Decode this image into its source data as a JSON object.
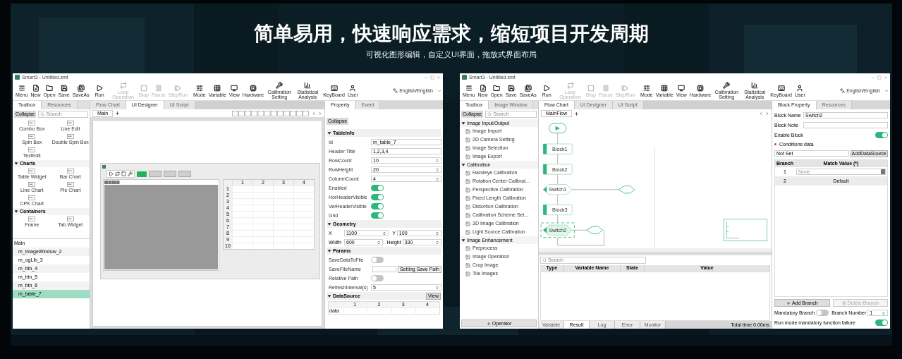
{
  "banner": {
    "title": "简单易用，快速响应需求，缩短项目开发周期",
    "subtitle": "可视化图形编辑，自定义UI界面，拖放式界面布局"
  },
  "windows": [
    {
      "kind": "ui-designer",
      "title": "Smart3 - Untitled.smt",
      "language": "English/English",
      "toolbar": [
        {
          "label": "Menu",
          "disabled": false
        },
        {
          "label": "New",
          "disabled": false
        },
        {
          "label": "Open",
          "disabled": false
        },
        {
          "label": "Save",
          "disabled": false
        },
        {
          "label": "SaveAs",
          "disabled": false
        },
        {
          "label": "Run",
          "disabled": false
        },
        {
          "label": "Loop Operation",
          "disabled": true
        },
        {
          "label": "Stop",
          "disabled": true
        },
        {
          "label": "Pause",
          "disabled": true
        },
        {
          "label": "StepRun",
          "disabled": true
        },
        {
          "label": "Mode",
          "disabled": false
        },
        {
          "label": "Variable",
          "disabled": false
        },
        {
          "label": "View",
          "disabled": false
        },
        {
          "label": "Hardware",
          "disabled": false
        },
        {
          "label": "Calibration Setting",
          "disabled": false
        },
        {
          "label": "Statistical Analysis",
          "disabled": false
        },
        {
          "label": "KeyBoard",
          "disabled": false
        },
        {
          "label": "User",
          "disabled": false
        }
      ],
      "left_tabs": [
        {
          "label": "Toolbox",
          "selected": true
        },
        {
          "label": "Resources",
          "selected": false
        }
      ],
      "collapse": "Collapse",
      "search_placeholder": "Search",
      "widgets_top": [
        "Combo Box",
        "Line Edit",
        "Spin Box",
        "Double Spin Box",
        "TextEdit"
      ],
      "widget_groups": [
        {
          "title": "Charts",
          "expanded": true,
          "items": [
            "Table Widget",
            "Bar Chart",
            "Line Chart",
            "Pie Chart",
            "CPK Chart"
          ]
        },
        {
          "title": "Containers",
          "expanded": true,
          "items": [
            "Frame",
            "Tab Widget"
          ]
        }
      ],
      "tree": {
        "title": "Main",
        "items": [
          {
            "label": "m_imageWindow_2",
            "selected": false
          },
          {
            "label": "m_ogLib_3",
            "selected": false
          },
          {
            "label": "m_btn_4",
            "selected": false
          },
          {
            "label": "m_btn_5",
            "selected": false
          },
          {
            "label": "m_btn_6",
            "selected": false
          },
          {
            "label": "m_table_7",
            "selected": true
          }
        ]
      },
      "center_tabs": [
        {
          "label": "Flow Chart",
          "selected": false
        },
        {
          "label": "UI Designer",
          "selected": true
        },
        {
          "label": "UI Script",
          "selected": false
        }
      ],
      "page_tabs": [
        {
          "label": "Main",
          "selected": true
        }
      ],
      "form": {
        "table_columns": [
          "1",
          "2",
          "3",
          "4"
        ],
        "table_rows": [
          "1",
          "2",
          "3",
          "4",
          "5",
          "6",
          "7",
          "8",
          "9",
          "10"
        ]
      },
      "right_tabs": [
        {
          "label": "Property",
          "selected": true
        },
        {
          "label": "Event",
          "selected": false
        }
      ],
      "property_collapse": "Collapse",
      "sections": [
        {
          "title": "TableInfo",
          "expanded": true,
          "rows": [
            {
              "kind": "text",
              "label": "Id",
              "value": "m_table_7"
            },
            {
              "kind": "text",
              "label": "Header Title",
              "value": "1,2,3,4"
            },
            {
              "kind": "spin",
              "label": "RowCount",
              "value": "10"
            },
            {
              "kind": "spin",
              "label": "RowHeight",
              "value": "20"
            },
            {
              "kind": "spin",
              "label": "ColumnCount",
              "value": "4"
            },
            {
              "kind": "toggle",
              "label": "Enabled",
              "on": true
            },
            {
              "kind": "toggle",
              "label": "HorHeaderVisible",
              "on": true
            },
            {
              "kind": "toggle",
              "label": "VerHeaderVisible",
              "on": true
            },
            {
              "kind": "toggle",
              "label": "Grid",
              "on": true
            }
          ]
        },
        {
          "title": "Geometry",
          "expanded": true,
          "rows": [
            {
              "kind": "pair",
              "label": "X",
              "value": "1100",
              "label2": "Y",
              "value2": "100"
            },
            {
              "kind": "pair",
              "label": "Width",
              "value": "600",
              "label2": "Height",
              "value2": "330"
            }
          ]
        },
        {
          "title": "Params",
          "expanded": true,
          "rows": [
            {
              "kind": "toggle",
              "label": "SaveDataToFile",
              "on": false
            },
            {
              "kind": "path",
              "label": "SaveFileName",
              "button": "Setting Save Path"
            },
            {
              "kind": "toggle",
              "label": "Relative Path",
              "on": false
            },
            {
              "kind": "spin",
              "label": "RefreshInterval(s)",
              "value": "5"
            }
          ]
        },
        {
          "title": "DataSource",
          "expanded": true,
          "button": "View",
          "table": {
            "columns": [
              "1",
              "2",
              "3",
              "4"
            ],
            "rows": [
              "data"
            ]
          }
        }
      ]
    },
    {
      "kind": "flow-chart",
      "title": "Smart3 - Untitled.smt",
      "language": "English/English",
      "toolbar": [
        {
          "label": "Menu",
          "disabled": false
        },
        {
          "label": "New",
          "disabled": false
        },
        {
          "label": "Open",
          "disabled": false
        },
        {
          "label": "Save",
          "disabled": false
        },
        {
          "label": "SaveAs",
          "disabled": false
        },
        {
          "label": "Run",
          "disabled": false
        },
        {
          "label": "Loop Operation",
          "disabled": true
        },
        {
          "label": "Stop",
          "disabled": true
        },
        {
          "label": "Pause",
          "disabled": true
        },
        {
          "label": "StepRun",
          "disabled": true
        },
        {
          "label": "Mode",
          "disabled": false
        },
        {
          "label": "Variable",
          "disabled": false
        },
        {
          "label": "View",
          "disabled": false
        },
        {
          "label": "Hardware",
          "disabled": false
        },
        {
          "label": "Calibration Setting",
          "disabled": false
        },
        {
          "label": "Statistical Analysis",
          "disabled": false
        },
        {
          "label": "KeyBoard",
          "disabled": false
        },
        {
          "label": "User",
          "disabled": false
        }
      ],
      "left_tabs": [
        {
          "label": "Toolbox",
          "selected": true
        },
        {
          "label": "Image Window",
          "selected": false
        }
      ],
      "collapse": "Collapse",
      "search_placeholder": "Search",
      "operator_groups": [
        {
          "title": "Image Input/Output",
          "expanded": true,
          "items": [
            "Image Import",
            "2D Camera Setting",
            "Image Selection",
            "Image Export"
          ]
        },
        {
          "title": "Calibration",
          "expanded": true,
          "items": [
            "Handeye Calibration",
            "Rotation Center Calibrat...",
            "Perspective Calibration",
            "Fixed Length Calibration",
            "Distortion Calibration",
            "Calibration Scheme Sel...",
            "3D Image Calibration",
            "Light Source Calibration"
          ]
        },
        {
          "title": "Image Enhancement",
          "expanded": true,
          "items": [
            "Preprocess",
            "Image Operation",
            "Crop Image",
            "Tile Images"
          ]
        }
      ],
      "operator_button": "Operator",
      "center_tabs": [
        {
          "label": "Flow Chart",
          "selected": true
        },
        {
          "label": "UI Designer",
          "selected": false
        },
        {
          "label": "UI Script",
          "selected": false
        }
      ],
      "page_tabs": [
        {
          "label": "MainFlow",
          "selected": true
        }
      ],
      "flow_nodes": [
        {
          "kind": "start",
          "selected": false
        },
        {
          "kind": "block",
          "label": "Block1",
          "selected": false
        },
        {
          "kind": "block",
          "label": "Block2",
          "selected": false
        },
        {
          "kind": "switch",
          "label": "Switch1",
          "selected": false
        },
        {
          "kind": "block",
          "label": "Block3",
          "selected": false
        },
        {
          "kind": "switch",
          "label": "Switch2",
          "selected": true
        }
      ],
      "results": {
        "search_placeholder": "Search",
        "columns": [
          "Type",
          "Variable Name",
          "State",
          "Value"
        ]
      },
      "bottom_tabs": [
        {
          "label": "Variable",
          "selected": false
        },
        {
          "label": "Result",
          "selected": true
        },
        {
          "label": "Log",
          "selected": false
        },
        {
          "label": "Error",
          "selected": false
        },
        {
          "label": "Monitor",
          "selected": false
        }
      ],
      "status": "Total time 0.00ms",
      "right_tabs": [
        {
          "label": "Block Property",
          "selected": true
        },
        {
          "label": "Resources",
          "selected": false
        }
      ],
      "block": {
        "name_label": "Block Name",
        "name": "Switch2",
        "note_label": "Block Note",
        "enable_label": "Enable Block",
        "enabled": true,
        "conditions_label": "Conditions data",
        "source": "Not Set",
        "source_button": "AddDataSource",
        "branch_columns": [
          "Branch",
          "Match Value (*)"
        ],
        "branches": [
          {
            "kind": "dropdown",
            "branch": "1",
            "value": "None"
          },
          {
            "kind": "text",
            "branch": "2",
            "value": "Default"
          }
        ],
        "add_branch": "Add Branch",
        "delete_branch": "Delete Branch",
        "delete_disabled": true,
        "mandatory_label": "Mandatory Branch",
        "mandatory": false,
        "branch_number_label": "Branch Number",
        "branch_number": "1",
        "failure_label": "Run mode mandatory function failure",
        "failure": true
      }
    }
  ]
}
